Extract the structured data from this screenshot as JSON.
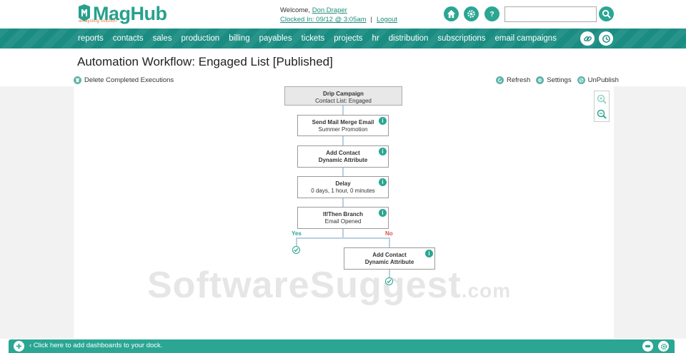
{
  "header": {
    "logo_main": "Mag",
    "logo_hub": "Hub",
    "logo_tagline": "an aysling solution",
    "welcome_prefix": "Welcome,",
    "user_name": "Don Draper",
    "clock_status": "Clocked In: 09/12 @ 3:05am",
    "logout_label": "Logout",
    "search_value": ""
  },
  "nav": {
    "items": [
      "reports",
      "contacts",
      "sales",
      "production",
      "billing",
      "payables",
      "tickets",
      "projects",
      "hr",
      "distribution",
      "subscriptions",
      "email campaigns"
    ]
  },
  "page": {
    "title": "Automation Workflow: Engaged List [Published]",
    "delete_label": "Delete Completed Executions",
    "refresh_label": "Refresh",
    "settings_label": "Settings",
    "unpublish_label": "UnPublish"
  },
  "workflow": {
    "start": {
      "title": "Drip Campaign",
      "subtitle": "Contact List: Engaged"
    },
    "step1": {
      "title": "Send Mail Merge Email",
      "subtitle": "Summer Promotion"
    },
    "step2": {
      "title": "Add Contact",
      "subtitle": "Dynamic Attribute"
    },
    "step3": {
      "title": "Delay",
      "subtitle": "0 days, 1 hour, 0 minutes"
    },
    "step4": {
      "title": "If/Then Branch",
      "subtitle": "Email Opened"
    },
    "yes_label": "Yes",
    "no_label": "No",
    "step5": {
      "title": "Add Contact",
      "subtitle": "Dynamic Attribute"
    },
    "info_glyph": "i"
  },
  "watermark": {
    "main": "SoftwareSuggest",
    "suffix": ".com"
  },
  "dock": {
    "text": "Click here to add dashboards to your dock."
  },
  "colors": {
    "brand": "#2aa693",
    "nav": "#1a8c82",
    "no": "#d9534f"
  }
}
